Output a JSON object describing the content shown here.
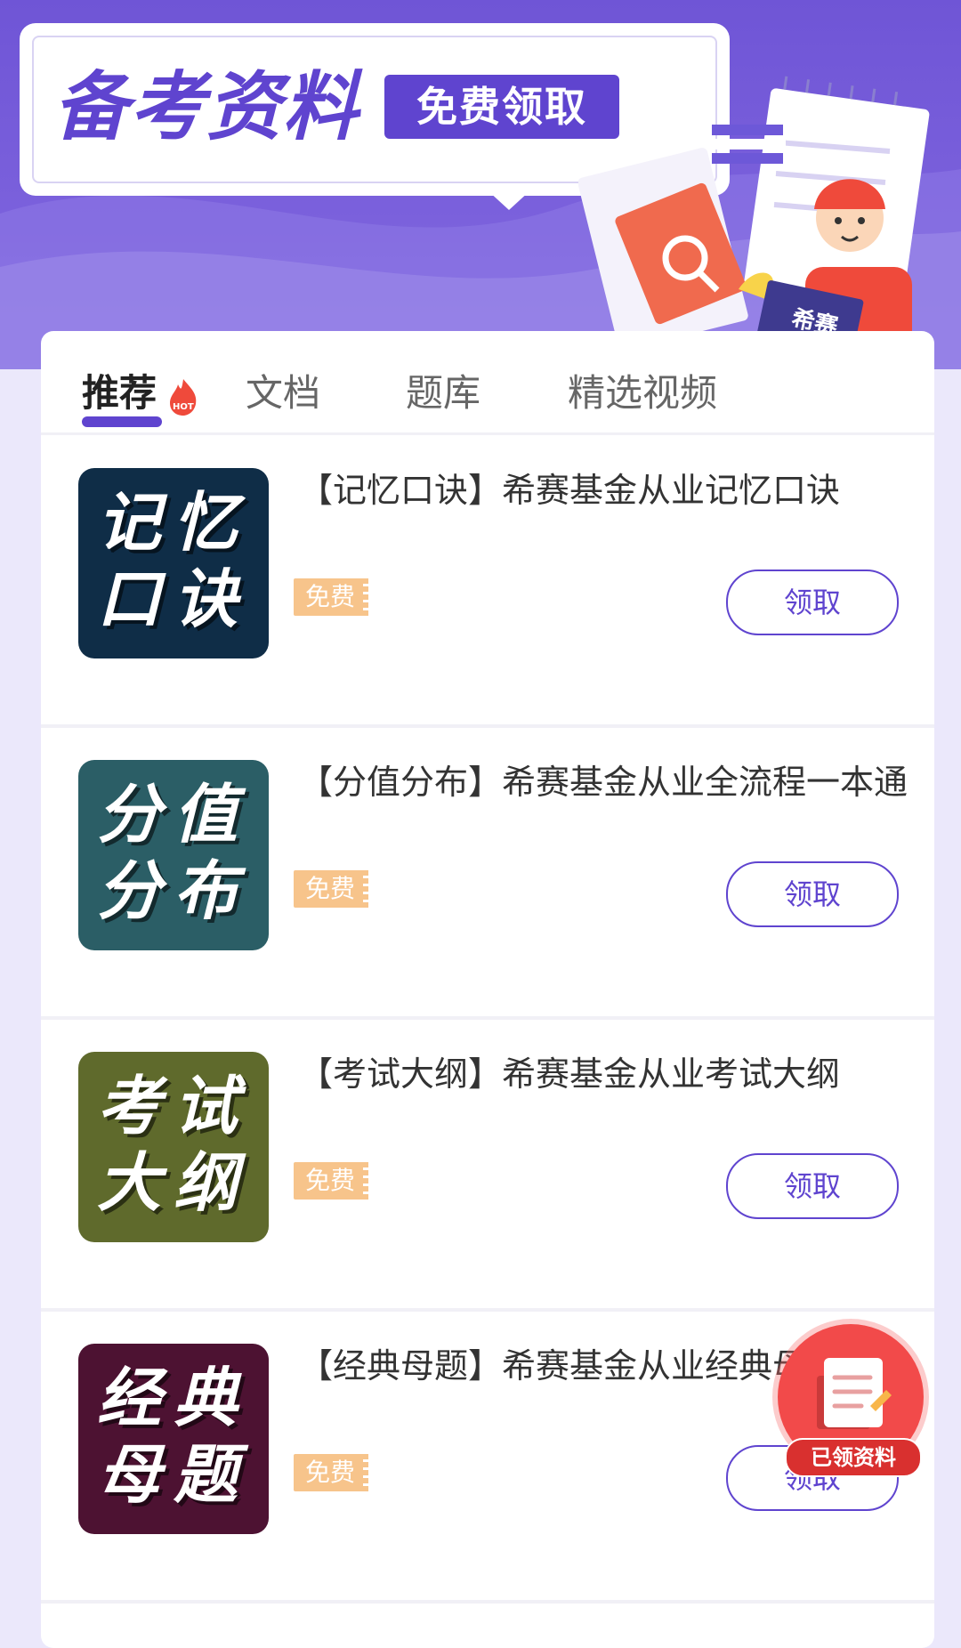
{
  "banner": {
    "title": "备考资料",
    "badge": "免费领取",
    "illustration_label": "希赛"
  },
  "tabs": [
    {
      "label": "推荐",
      "active": true,
      "hot": true
    },
    {
      "label": "文档",
      "active": false
    },
    {
      "label": "题库",
      "active": false
    },
    {
      "label": "精选视频",
      "active": false
    }
  ],
  "items": [
    {
      "thumb_line1": "记忆",
      "thumb_line2": "口诀",
      "thumb_color": "#0f2d47",
      "title": "【记忆口诀】希赛基金从业记忆口诀",
      "badge": "免费",
      "button": "领取"
    },
    {
      "thumb_line1": "分值",
      "thumb_line2": "分布",
      "thumb_color": "#2b5e66",
      "title": "【分值分布】希赛基金从业全流程一本通",
      "badge": "免费",
      "button": "领取"
    },
    {
      "thumb_line1": "考试",
      "thumb_line2": "大纲",
      "thumb_color": "#5f6a2c",
      "title": "【考试大纲】希赛基金从业考试大纲",
      "badge": "免费",
      "button": "领取"
    },
    {
      "thumb_line1": "经典",
      "thumb_line2": "母题",
      "thumb_color": "#4d1232",
      "title": "【经典母题】希赛基金从业经典母题",
      "badge": "免费",
      "button": "领取"
    }
  ],
  "fab": {
    "label": "已领资料",
    "icon": "document-icon"
  },
  "colors": {
    "accent": "#5f44cf",
    "badge": "#f7c48b",
    "fab": "#f24a4a"
  }
}
